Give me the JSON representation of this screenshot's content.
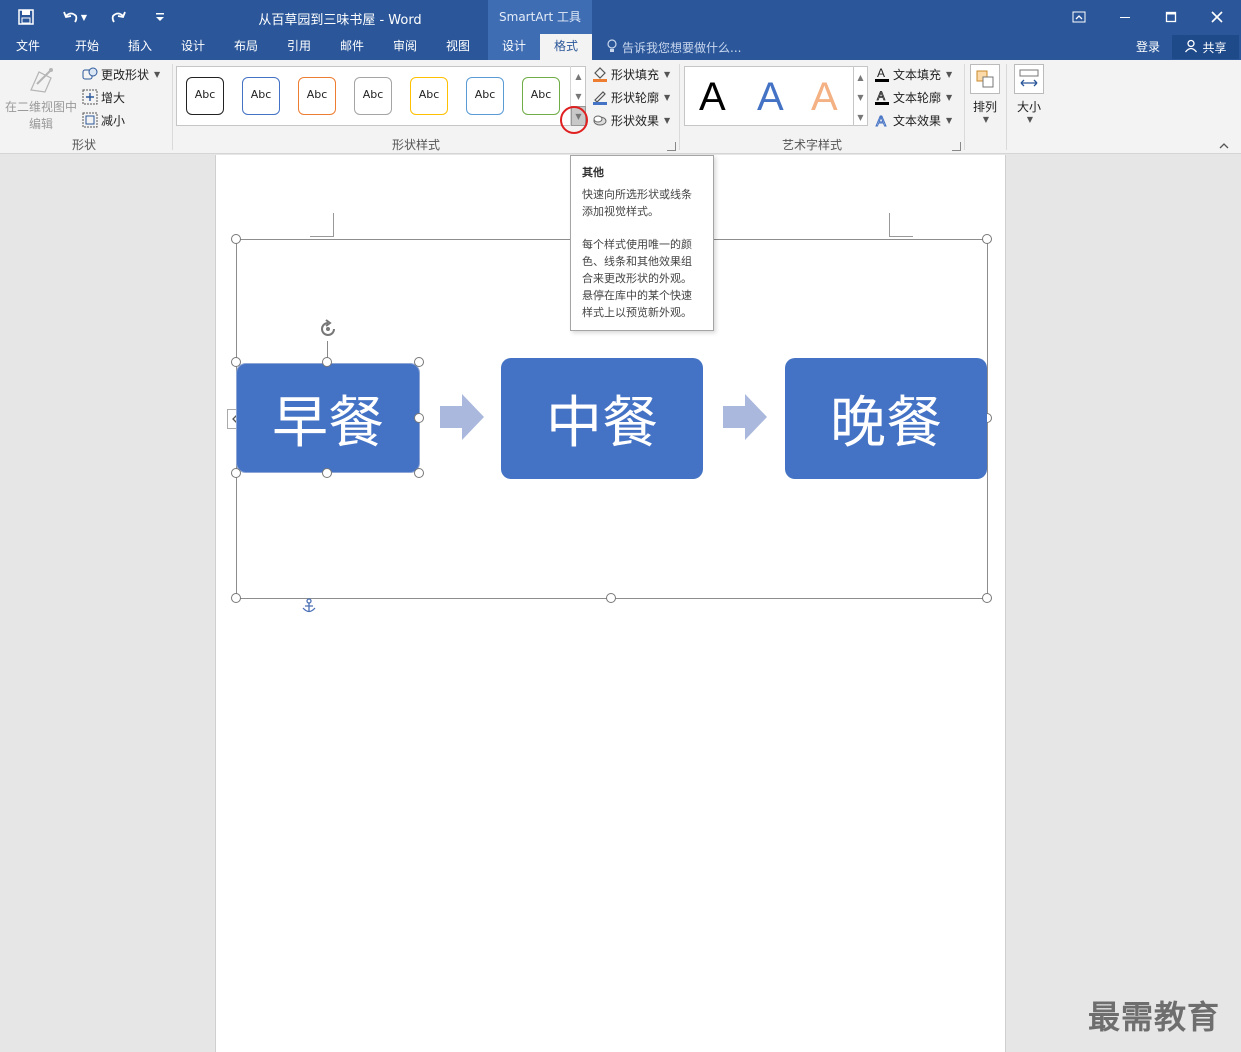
{
  "window": {
    "title": "从百草园到三味书屋 - Word",
    "contextual_header": "SmartArt 工具"
  },
  "tabs": [
    {
      "label": "文件"
    },
    {
      "label": "开始"
    },
    {
      "label": "插入"
    },
    {
      "label": "设计"
    },
    {
      "label": "布局"
    },
    {
      "label": "引用"
    },
    {
      "label": "邮件"
    },
    {
      "label": "审阅"
    },
    {
      "label": "视图"
    },
    {
      "label": "设计"
    },
    {
      "label": "格式"
    }
  ],
  "tell_me": "告诉我您想要做什么...",
  "login": "登录",
  "share": "共享",
  "ribbon": {
    "shape_group": {
      "edit_2d_line1": "在二维视图中",
      "edit_2d_line2": "编辑",
      "change_shape": "更改形状",
      "larger": "增大",
      "smaller": "减小",
      "label": "形状"
    },
    "shape_styles": {
      "swatch_text": "Abc",
      "swatch_colors": [
        "#222222",
        "#4472c4",
        "#ed7d31",
        "#a5a5a5",
        "#ffc000",
        "#5b9bd5",
        "#70ad47"
      ],
      "fill": "形状填充",
      "outline": "形状轮廓",
      "effects": "形状效果",
      "label": "形状样式"
    },
    "wordart": {
      "letter": "A",
      "fill": "文本填充",
      "outline": "文本轮廓",
      "effects": "文本效果",
      "label": "艺术字样式"
    },
    "arrange": "排列",
    "size": "大小"
  },
  "tooltip": {
    "title": "其他",
    "p1": "快速向所选形状或线条添加视觉样式。",
    "p2": "每个样式使用唯一的颜色、线条和其他效果组合来更改形状的外观。悬停在库中的某个快速样式上以预览新外观。"
  },
  "smartart": {
    "nodes": [
      "早餐",
      "中餐",
      "晚餐"
    ],
    "node_color": "#4472c4",
    "arrow_color": "#aab8dd"
  },
  "watermark": "最需教育"
}
